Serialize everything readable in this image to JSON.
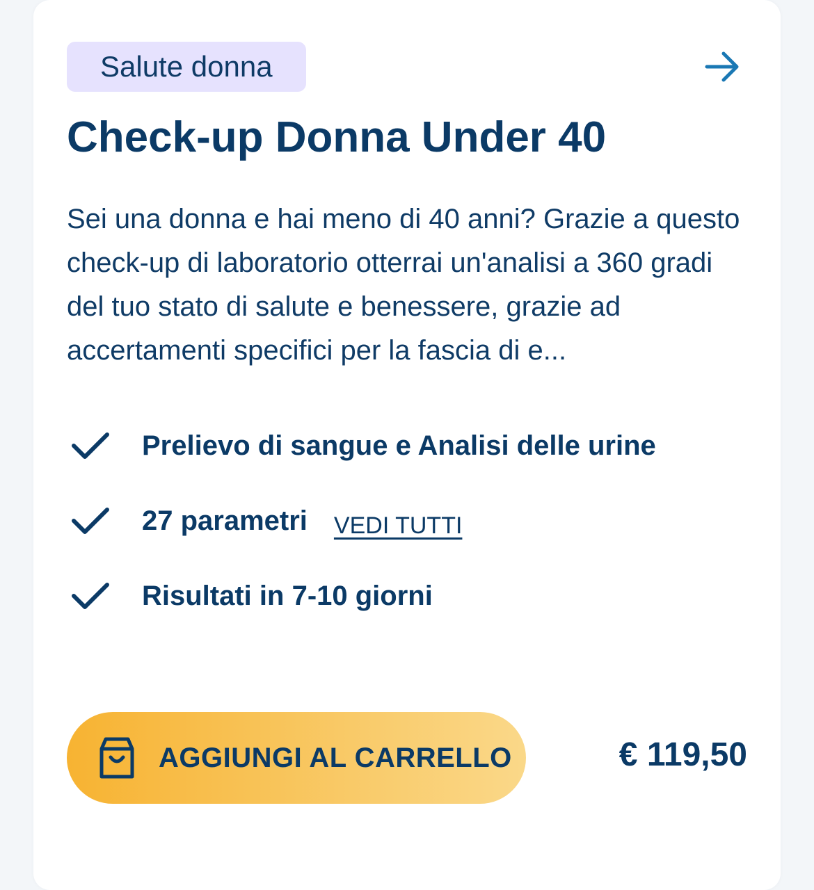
{
  "card": {
    "category_tag": "Salute donna",
    "title": "Check-up Donna Under 40",
    "description": "Sei una donna e hai meno di 40 anni? Grazie a questo check-up di laboratorio otterrai un'analisi a 360 gradi del tuo stato di salute e benessere, grazie ad accertamenti specifici per la fascia di e...",
    "features": [
      {
        "text": "Prelievo di sangue e Analisi delle urine",
        "icon": "check-icon"
      },
      {
        "text": "27 parametri",
        "icon": "check-icon",
        "link": "VEDI TUTTI"
      },
      {
        "text": "Risultati in 7-10 giorni",
        "icon": "check-icon"
      }
    ],
    "cart_button_label": "AGGIUNGI AL CARRELLO",
    "price": "€ 119,50"
  },
  "colors": {
    "primary_text": "#0b3a66",
    "tag_background": "#e6e2fe",
    "arrow": "#1a78b4",
    "button_gradient_start": "#f7b332",
    "button_gradient_end": "#fad889"
  },
  "icons": {
    "arrow": "arrow-right-icon",
    "check": "check-icon",
    "cart": "shopping-bag-icon"
  }
}
